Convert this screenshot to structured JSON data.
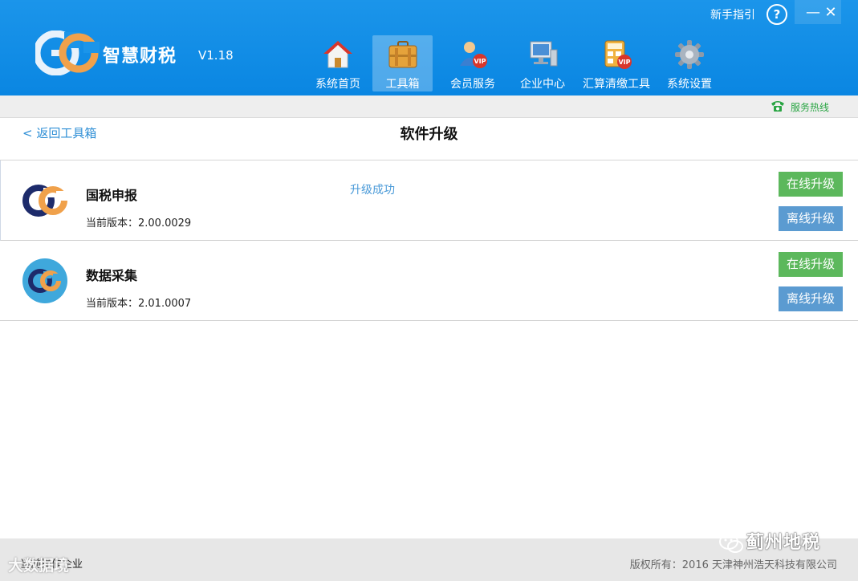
{
  "app": {
    "name": "智慧财税",
    "version": "V1.18",
    "guide_label": "新手指引",
    "help_label": "?",
    "minimize_label": "—",
    "close_label": "✕"
  },
  "nav": {
    "items": [
      {
        "label": "系统首页",
        "icon": "house-icon"
      },
      {
        "label": "工具箱",
        "icon": "toolbox-icon",
        "active": true
      },
      {
        "label": "会员服务",
        "icon": "vip-member-icon"
      },
      {
        "label": "企业中心",
        "icon": "computer-icon"
      },
      {
        "label": "汇算清缴工具",
        "icon": "calculator-vip-icon"
      },
      {
        "label": "系统设置",
        "icon": "gear-icon"
      }
    ]
  },
  "service": {
    "hotline_label": "服务热线"
  },
  "page": {
    "back_label": "< 返回工具箱",
    "title": "软件升级"
  },
  "software": [
    {
      "name": "国税申报",
      "version": "当前版本：2.00.0029",
      "status": "升级成功",
      "online_label": "在线升级",
      "offline_label": "离线升级"
    },
    {
      "name": "数据采集",
      "version": "当前版本：2.01.0007",
      "status": "",
      "online_label": "在线升级",
      "offline_label": "离线升级"
    }
  ],
  "footer": {
    "current_company_label": "当前操作企业",
    "copyright": "版权所有：2016 天津神州浩天科技有限公司"
  },
  "watermark": {
    "right_text": "蓟州地税",
    "left_text": "大数据境"
  },
  "colors": {
    "header_blue": "#0a86e2",
    "online_green": "#5cb85c",
    "offline_blue": "#5b9bd1",
    "status_blue": "#4a9ad8",
    "hotline_green": "#2aa544"
  }
}
